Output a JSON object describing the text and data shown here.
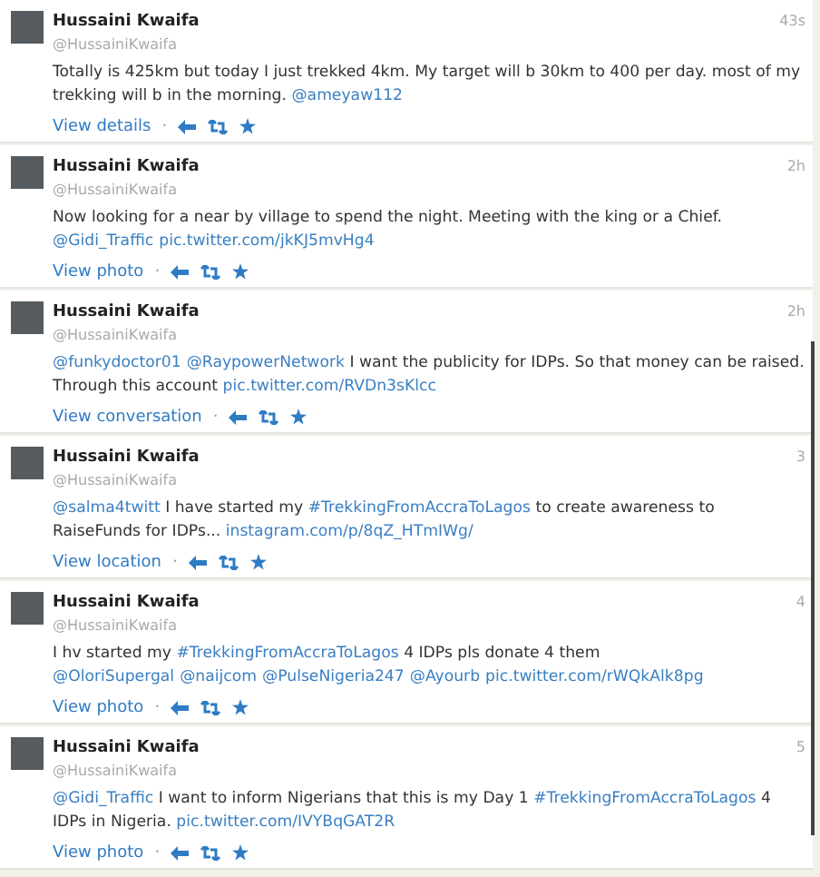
{
  "tweets": [
    {
      "name": "Hussaini Kwaifa",
      "handle": "@HussainiKwaifa",
      "time": "43s",
      "text": [
        {
          "kind": "plain",
          "text": "Totally is 425km but today I just trekked 4km. My target will b 30km to 400 per day. most of my trekking will b in the morning. "
        },
        {
          "kind": "link",
          "text": "@ameyaw112"
        }
      ],
      "action": "View details"
    },
    {
      "name": "Hussaini Kwaifa",
      "handle": "@HussainiKwaifa",
      "time": "2h",
      "text": [
        {
          "kind": "plain",
          "text": "Now looking for a near by village to spend the night. Meeting with the king or a Chief. "
        },
        {
          "kind": "link",
          "text": "@Gidi_Traffic"
        },
        {
          "kind": "link",
          "text": "pic.twitter.com/jkKJ5mvHg4"
        }
      ],
      "action": "View photo"
    },
    {
      "name": "Hussaini Kwaifa",
      "handle": "@HussainiKwaifa",
      "time": "2h",
      "text": [
        {
          "kind": "link",
          "text": "@funkydoctor01"
        },
        {
          "kind": "link",
          "text": "@RaypowerNetwork"
        },
        {
          "kind": "plain",
          "text": " I want the publicity for IDPs. So that money can be raised. Through this account "
        },
        {
          "kind": "link",
          "text": "pic.twitter.com/RVDn3sKlcc"
        }
      ],
      "action": "View conversation"
    },
    {
      "name": "Hussaini Kwaifa",
      "handle": "@HussainiKwaifa",
      "time": "3",
      "text": [
        {
          "kind": "link",
          "text": "@salma4twitt"
        },
        {
          "kind": "plain",
          "text": " I have started my "
        },
        {
          "kind": "link",
          "text": "#TrekkingFromAccraToLagos"
        },
        {
          "kind": "plain",
          "text": " to create awareness to RaiseFunds for IDPs... "
        },
        {
          "kind": "link",
          "text": "instagram.com/p/8qZ_HTmIWg/"
        }
      ],
      "action": "View location"
    },
    {
      "name": "Hussaini Kwaifa",
      "handle": "@HussainiKwaifa",
      "time": "4",
      "text": [
        {
          "kind": "plain",
          "text": "I hv started my "
        },
        {
          "kind": "link",
          "text": "#TrekkingFromAccraToLagos"
        },
        {
          "kind": "plain",
          "text": " 4 IDPs pls donate 4 them "
        },
        {
          "kind": "link",
          "text": "@OloriSupergal"
        },
        {
          "kind": "link",
          "text": "@naijcom"
        },
        {
          "kind": "link",
          "text": "@PulseNigeria247"
        },
        {
          "kind": "link",
          "text": "@Ayourb"
        },
        {
          "kind": "link",
          "text": "pic.twitter.com/rWQkAlk8pg"
        }
      ],
      "action": "View photo"
    },
    {
      "name": "Hussaini Kwaifa",
      "handle": "@HussainiKwaifa",
      "time": "5",
      "text": [
        {
          "kind": "link",
          "text": "@Gidi_Traffic"
        },
        {
          "kind": "plain",
          "text": " I want to inform Nigerians that this is my Day 1 "
        },
        {
          "kind": "link",
          "text": "#TrekkingFromAccraToLagos"
        },
        {
          "kind": "plain",
          "text": " 4 IDPs in Nigeria. "
        },
        {
          "kind": "link",
          "text": "pic.twitter.com/IVYBqGAT2R"
        }
      ],
      "action": "View photo"
    }
  ],
  "action_separator": "·"
}
